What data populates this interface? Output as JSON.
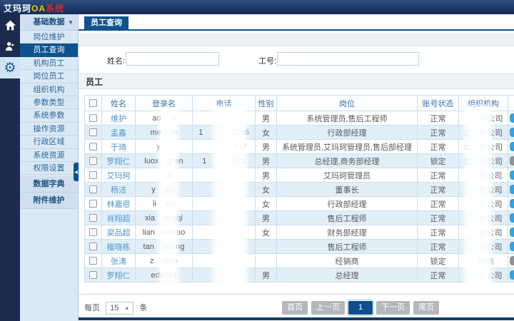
{
  "app": {
    "title_brand": "艾玛珂",
    "title_mid": "OA",
    "title_suf": "系统"
  },
  "icons": {
    "dropdown_arrow": "▼",
    "collapse_arrow": "◀",
    "gear": "⚙",
    "select_arrow": "▼"
  },
  "sidebar": {
    "group_label": "基础数据",
    "items": [
      "岗位维护",
      "员工查询",
      "机构员工",
      "岗位员工",
      "组织机构",
      "参数类型",
      "系统参数",
      "操作资源",
      "行政区域",
      "系统资源",
      "权限设置"
    ],
    "active_item": "员工查询",
    "collapsed_groups": [
      "数据字典",
      "附件维护"
    ]
  },
  "tab": {
    "label": "员工查询"
  },
  "search": {
    "name_label": "姓名:",
    "code_label": "工号:",
    "name_value": "",
    "code_value": ""
  },
  "panel": {
    "title": "员工"
  },
  "table": {
    "columns": [
      "姓名",
      "登录名",
      "电话",
      "性别",
      "岗位",
      "账号状态",
      "组织机构"
    ],
    "rows": [
      {
        "name": "维护",
        "login": {
          "pre": "ad",
          "gap": 14,
          "suf": "n"
        },
        "phone": {
          "pre": "",
          "gap": 52,
          "suf": ""
        },
        "gender": "男",
        "position": "系统管理员,售后工程师",
        "status": "正常",
        "org": {
          "pre": "",
          "gap": 22,
          "suf": "分公司"
        },
        "locked": false
      },
      {
        "name": "孟鑫",
        "login": {
          "pre": "me",
          "gap": 14,
          "suf": "in"
        },
        "phone": {
          "pre": "1",
          "gap": 40,
          "suf": "7106"
        },
        "gender": "女",
        "position": "行政部经理",
        "status": "正常",
        "org": {
          "pre": "北",
          "gap": 10,
          "suf": "分公司"
        },
        "locked": false
      },
      {
        "name": "于琦",
        "login": {
          "pre": "y",
          "gap": 12,
          "suf": "i"
        },
        "phone": {
          "pre": "",
          "gap": 46,
          "suf": "247"
        },
        "gender": "男",
        "position": "系统管理员,艾玛珂管理员,售后部经理",
        "status": "正常",
        "org": {
          "pre": "北",
          "gap": 10,
          "suf": "分公司"
        },
        "locked": false
      },
      {
        "name": "罗翔仁",
        "login": {
          "pre": "luox",
          "gap": 12,
          "suf": "gren"
        },
        "phone": {
          "pre": "1",
          "gap": 36,
          "suf": "821"
        },
        "gender": "男",
        "position": "总经理,商务部经理",
        "status": "锁定",
        "org": {
          "pre": "北",
          "gap": 10,
          "suf": "分公司"
        },
        "locked": true
      },
      {
        "name": "艾玛珂",
        "login": {
          "pre": "",
          "gap": 16,
          "suf": "ac"
        },
        "phone": {
          "pre": "",
          "gap": 0,
          "suf": ""
        },
        "gender": "男",
        "position": "艾玛珂管理员",
        "status": "正常",
        "org": {
          "pre": "",
          "gap": 20,
          "suf": "总公司"
        },
        "locked": false
      },
      {
        "name": "杨洁",
        "login": {
          "pre": "y",
          "gap": 12,
          "suf": "gjie"
        },
        "phone": {
          "pre": "",
          "gap": 0,
          "suf": ""
        },
        "gender": "女",
        "position": "董事长",
        "status": "正常",
        "org": {
          "pre": "",
          "gap": 20,
          "suf": "总公司"
        },
        "locked": false
      },
      {
        "name": "林嘉恩",
        "login": {
          "pre": "li",
          "gap": 14,
          "suf": "en"
        },
        "phone": {
          "pre": "",
          "gap": 0,
          "suf": ""
        },
        "gender": "女",
        "position": "行政部经理",
        "status": "正常",
        "org": {
          "pre": "",
          "gap": 20,
          "suf": "总公司"
        },
        "locked": false
      },
      {
        "name": "肖翔超",
        "login": {
          "pre": "xia",
          "gap": 12,
          "suf": "angqi"
        },
        "phone": {
          "pre": "",
          "gap": 0,
          "suf": ""
        },
        "gender": "男",
        "position": "售后工程师",
        "status": "正常",
        "org": {
          "pre": "",
          "gap": 20,
          "suf": "总公司"
        },
        "locked": false
      },
      {
        "name": "梁品超",
        "login": {
          "pre": "lian",
          "gap": 10,
          "suf": "inchao"
        },
        "phone": {
          "pre": "",
          "gap": 0,
          "suf": ""
        },
        "gender": "女",
        "position": "财务部经理",
        "status": "正常",
        "org": {
          "pre": "",
          "gap": 20,
          "suf": "总公司"
        },
        "locked": false
      },
      {
        "name": "檀晓栋",
        "login": {
          "pre": "tan",
          "gap": 12,
          "suf": "odong"
        },
        "phone": {
          "pre": "",
          "gap": 0,
          "suf": ""
        },
        "gender": "",
        "position": "售后工程师",
        "status": "正常",
        "org": {
          "pre": "",
          "gap": 20,
          "suf": "分公司"
        },
        "locked": false
      },
      {
        "name": "张涛",
        "login": {
          "pre": "z",
          "gap": 12,
          "suf": "gtao"
        },
        "phone": {
          "pre": "",
          "gap": 0,
          "suf": ""
        },
        "gender": "",
        "position": "经销商",
        "status": "锁定",
        "org": {
          "pre": "",
          "gap": 8,
          "suf": "销商"
        },
        "locked": true
      },
      {
        "name": "罗翔仁",
        "login": {
          "pre": "edward",
          "gap": 0,
          "suf": ""
        },
        "phone": {
          "pre": "",
          "gap": 0,
          "suf": ""
        },
        "gender": "男",
        "position": "总经理",
        "status": "正常",
        "org": {
          "pre": "",
          "gap": 20,
          "suf": "分公司"
        },
        "locked": false
      }
    ]
  },
  "pager": {
    "per_page_label": "每页",
    "page_size_value": "15",
    "unit_label": "条",
    "buttons": [
      {
        "label": "首页",
        "active": false
      },
      {
        "label": "上一页",
        "active": false
      },
      {
        "label": "1",
        "active": true
      },
      {
        "label": "下一页",
        "active": false
      },
      {
        "label": "尾页",
        "active": false
      }
    ]
  }
}
